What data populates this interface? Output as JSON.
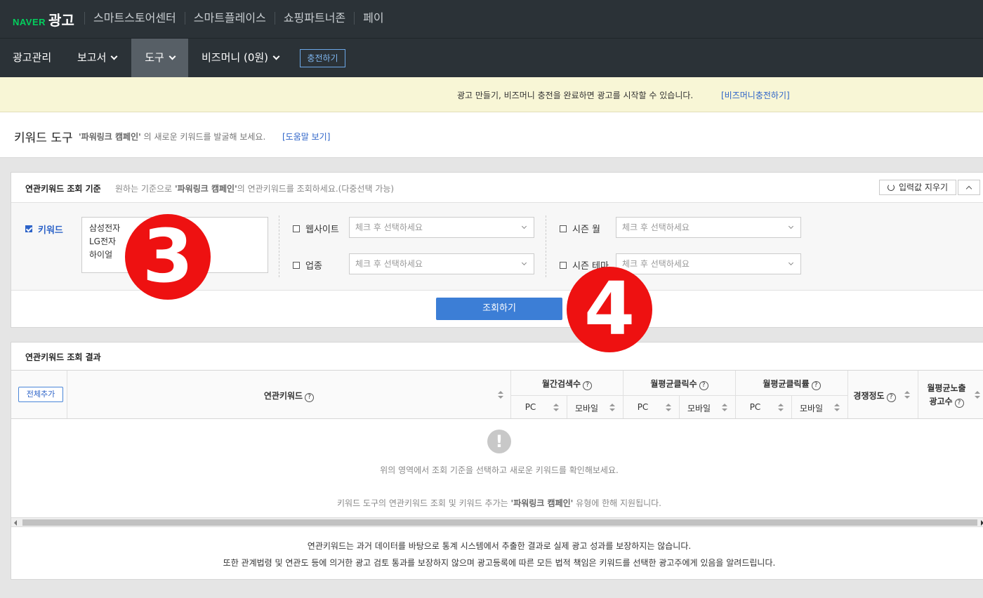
{
  "topbar": {
    "logo_brand": "NAVER",
    "logo_product": "광고",
    "links": [
      "스마트스토어센터",
      "스마트플레이스",
      "쇼핑파트너존",
      "페이"
    ]
  },
  "nav": {
    "items": [
      {
        "label": "광고관리"
      },
      {
        "label": "보고서"
      },
      {
        "label": "도구"
      },
      {
        "label": "비즈머니 (0원)"
      }
    ],
    "charge_label": "충전하기"
  },
  "notice": {
    "text": "광고 만들기, 비즈머니 충전을 완료하면 광고를 시작할 수 있습니다.",
    "link": "[비즈머니충전하기]"
  },
  "page": {
    "title": "키워드 도구",
    "campaign": "'파워링크 캠페인'",
    "subtitle_rest": "의 새로운 키워드를 발굴해 보세요.",
    "help_link": "[도움말 보기]"
  },
  "criteria": {
    "title": "연관키워드 조회 기준",
    "desc_pre": "원하는 기준으로",
    "desc_campaign": "'파워링크 캠페인'",
    "desc_post": "의 연관키워드를 조회하세요.(다중선택 가능)",
    "reset_label": "입력값 지우기",
    "keyword_label": "키워드",
    "keywords": [
      "삼성전자",
      "LG전자",
      "하이얼"
    ],
    "website_label": "웹사이트",
    "industry_label": "업종",
    "season_month_label": "시즌 월",
    "season_theme_label": "시즌 테마",
    "select_placeholder": "체크 후 선택하세요",
    "search_label": "조회하기"
  },
  "results": {
    "title": "연관키워드 조회 결과",
    "add_all_label": "전체추가",
    "col_keyword": "연관키워드",
    "col_monthly_search": "월간검색수",
    "col_avg_clicks": "월평균클릭수",
    "col_avg_ctr": "월평균클릭률",
    "col_competition": "경쟁정도",
    "col_impressions_1": "월평균노출",
    "col_impressions_2": "광고수",
    "sub_pc": "PC",
    "sub_mobile": "모바일",
    "help_glyph": "?",
    "empty_icon_glyph": "!",
    "empty_msg": "위의 영역에서 조회 기준을 선택하고 새로운 키워드를 확인해보세요.",
    "note_pre": "키워드 도구의 연관키워드 조회 및 키워드 추가는",
    "note_campaign": "'파워링크 캠페인'",
    "note_post": "유형에 한해 지원됩니다."
  },
  "disclaimer": {
    "line1": "연관키워드는 과거 데이터를 바탕으로 통계 시스템에서 추출한 결과로 실제 광고 성과를 보장하지는 않습니다.",
    "line2": "또한 관계법령 및 연관도 등에 의거한 광고 검토 통과를 보장하지 않으며 광고등록에 따른 모든 법적 책임은 키워드를 선택한 광고주에게 있음을 알려드립니다."
  },
  "markers": [
    "3",
    "4"
  ],
  "colors": {
    "accent": "#2d63c8",
    "primary_button": "#3c7ed6",
    "marker": "#ee1111",
    "naver_green": "#03cf5d"
  }
}
